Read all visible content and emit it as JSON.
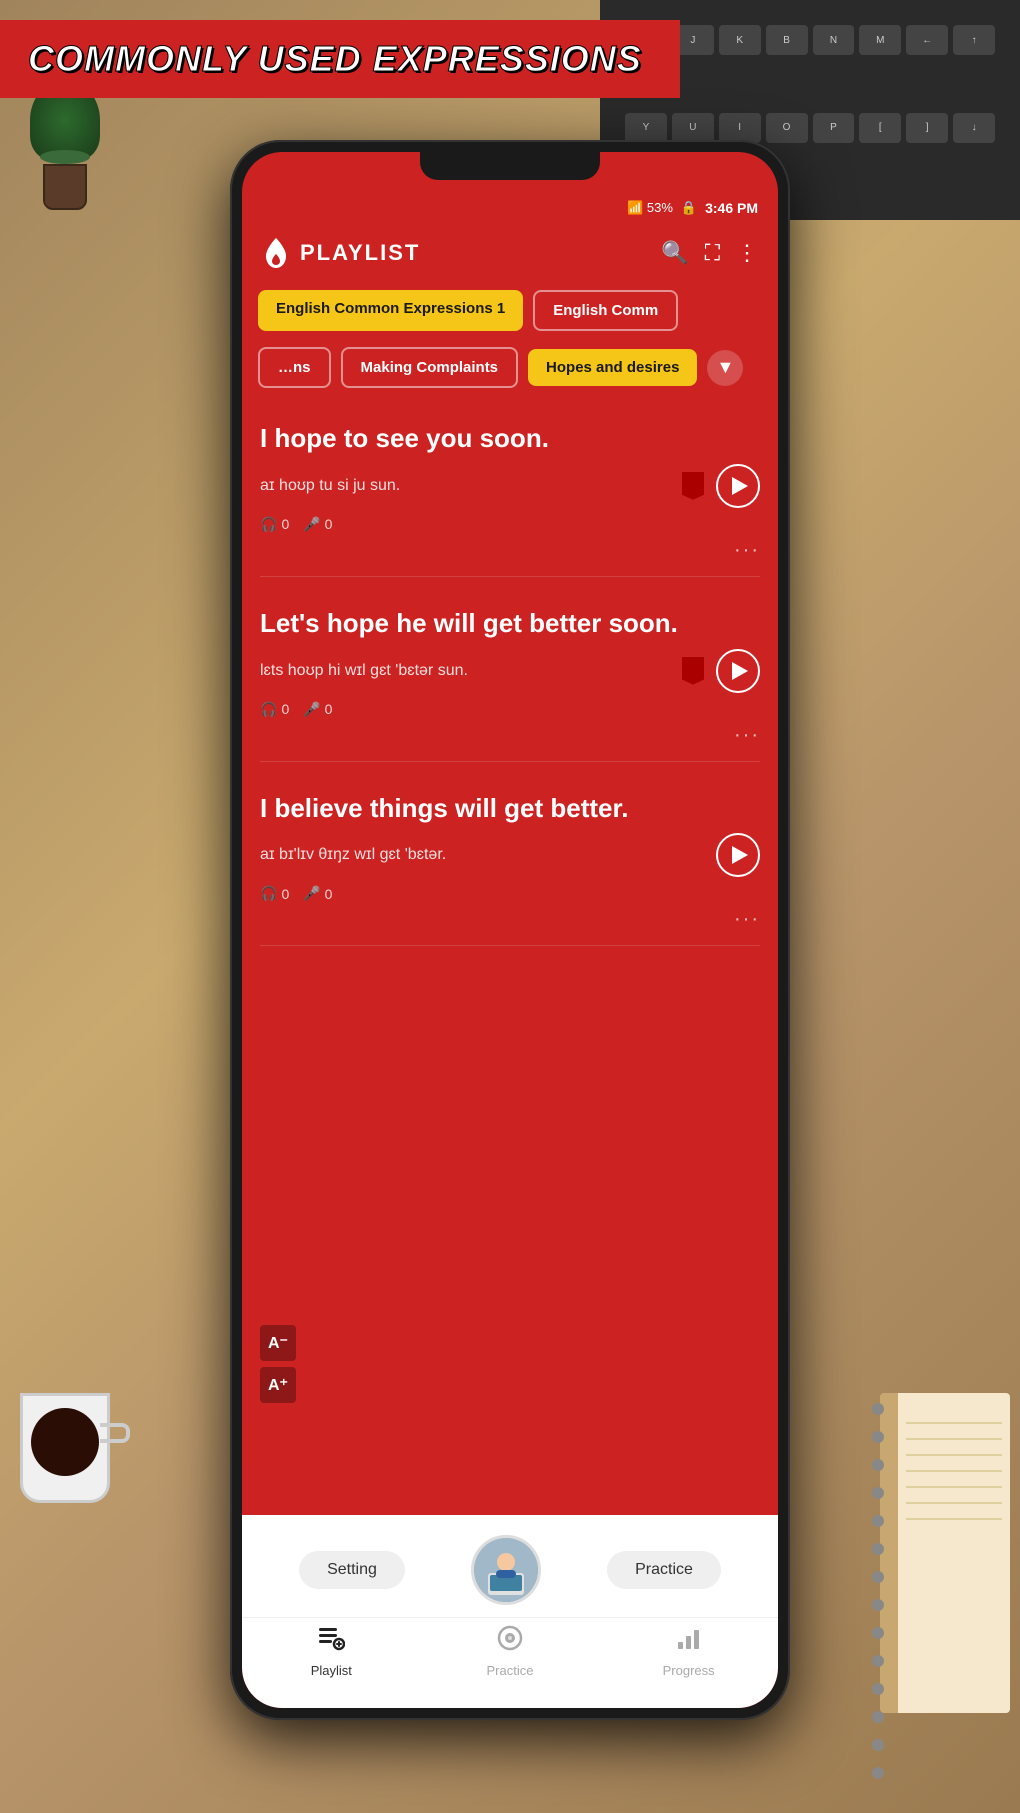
{
  "banner": {
    "text": "COMMONLY USED EXPRESSIONS"
  },
  "status": {
    "signal": "📶 53%",
    "battery": "🔒",
    "time": "3:46 PM"
  },
  "header": {
    "title": "PLAYLIST",
    "search_icon": "search",
    "expand_icon": "expand",
    "more_icon": "more"
  },
  "tabs_row1": [
    {
      "label": "English Common Expressions 1",
      "active": true
    },
    {
      "label": "English Comm",
      "active": false
    }
  ],
  "tabs_row2": [
    {
      "label": "…ns",
      "active": false
    },
    {
      "label": "Making Complaints",
      "active": false
    },
    {
      "label": "Hopes and desires",
      "active": true
    }
  ],
  "phrases": [
    {
      "text": "I hope to see you soon.",
      "phonetic": "aɪ hoʊp tu si ju sun.",
      "listens": "0",
      "speaks": "0",
      "bookmarked": true
    },
    {
      "text": "Let's hope he will get better soon.",
      "phonetic": "lɛts hoʊp hi wɪl gɛt 'bɛtər sun.",
      "listens": "0",
      "speaks": "0",
      "bookmarked": true
    },
    {
      "text": "I believe things will get better.",
      "phonetic": "aɪ bɪ'lɪv θɪŋz wɪl gɛt 'bɛtər.",
      "listens": "0",
      "speaks": "0",
      "bookmarked": false
    }
  ],
  "font_buttons": {
    "decrease": "A⁻",
    "increase": "A⁺"
  },
  "bottom_actions": {
    "setting": "Setting",
    "practice": "Practice"
  },
  "nav_items": [
    {
      "label": "Playlist",
      "active": true
    },
    {
      "label": "Practice",
      "active": false
    },
    {
      "label": "Progress",
      "active": false
    }
  ]
}
